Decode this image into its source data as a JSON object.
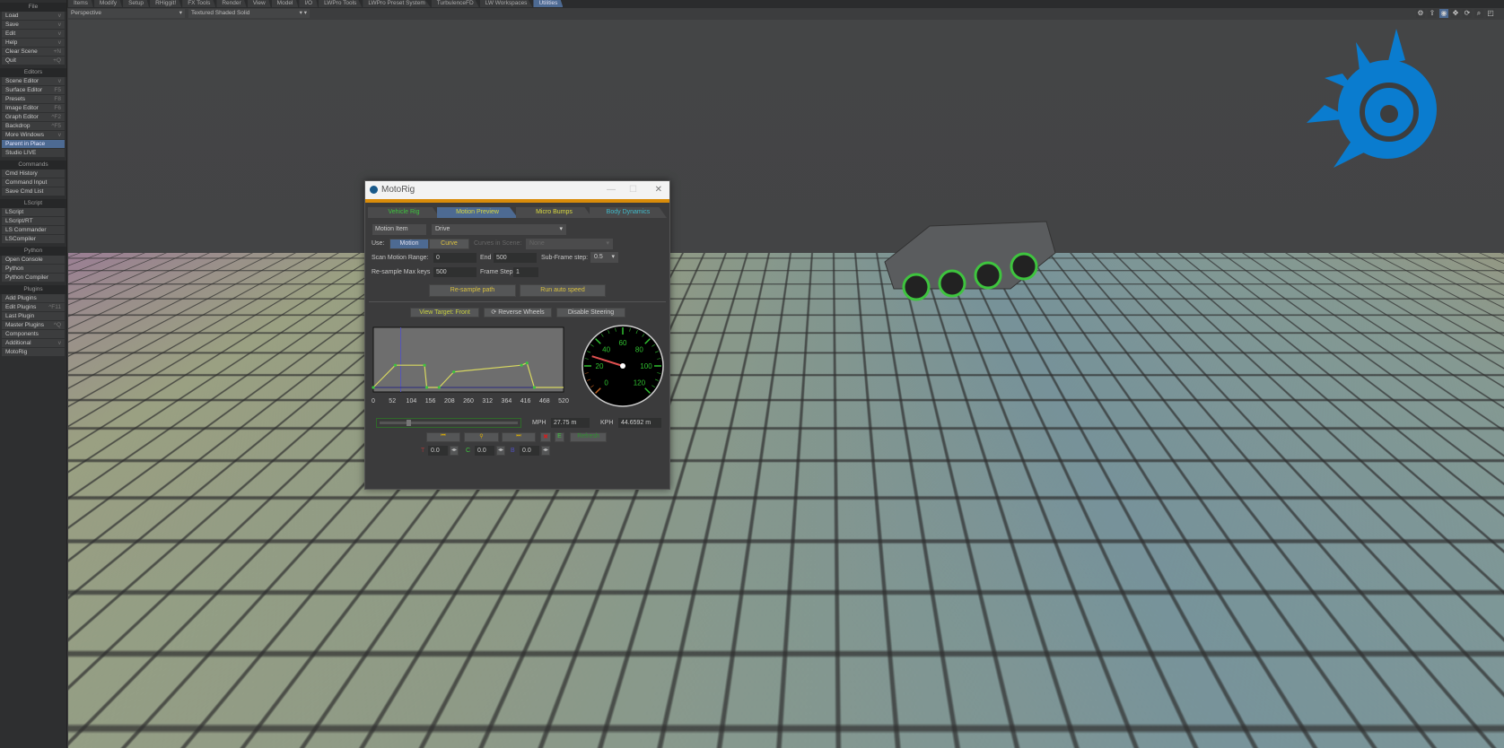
{
  "menu_tabs": [
    "Items",
    "Modify",
    "Setup",
    "RHiggit!",
    "FX Tools",
    "Render",
    "View",
    "Model",
    "I/O",
    "LWPro Tools",
    "LWPro Preset System",
    "TurbulenceFD",
    "LW Workspaces",
    "Utilities"
  ],
  "active_tab": "Utilities",
  "viewbar": {
    "view_mode": "Perspective",
    "render_mode": "Textured Shaded Solid"
  },
  "sidebar": [
    {
      "header": "File",
      "items": [
        {
          "label": "Load",
          "key": "v"
        },
        {
          "label": "Save",
          "key": "v"
        },
        {
          "label": "Edit",
          "key": "v"
        },
        {
          "label": "Help",
          "key": "v"
        },
        {
          "label": "Clear Scene",
          "key": "+N"
        },
        {
          "label": "Quit",
          "key": "+Q"
        }
      ]
    },
    {
      "header": "Editors",
      "items": [
        {
          "label": "Scene Editor",
          "key": "v"
        },
        {
          "label": "Surface Editor",
          "key": "F5"
        },
        {
          "label": "Presets",
          "key": "F8"
        },
        {
          "label": "Image Editor",
          "key": "F6"
        },
        {
          "label": "Graph Editor",
          "key": "^F2"
        },
        {
          "label": "Backdrop",
          "key": "^F5"
        },
        {
          "label": "More Windows",
          "key": "v"
        },
        {
          "label": "Parent in Place",
          "key": "",
          "selected": true
        },
        {
          "label": "Studio LIVE",
          "key": ""
        }
      ]
    },
    {
      "header": "Commands",
      "items": [
        {
          "label": "Cmd History",
          "key": ""
        },
        {
          "label": "Command Input",
          "key": ""
        },
        {
          "label": "Save Cmd List",
          "key": ""
        }
      ]
    },
    {
      "header": "LScript",
      "items": [
        {
          "label": "LScript",
          "key": ""
        },
        {
          "label": "LScript/RT",
          "key": ""
        },
        {
          "label": "LS Commander",
          "key": ""
        },
        {
          "label": "LSCompiler",
          "key": ""
        }
      ]
    },
    {
      "header": "Python",
      "items": [
        {
          "label": "Open Console",
          "key": ""
        },
        {
          "label": "Python",
          "key": ""
        },
        {
          "label": "Python Compiler",
          "key": ""
        }
      ]
    },
    {
      "header": "Plugins",
      "items": [
        {
          "label": "Add Plugins",
          "key": ""
        },
        {
          "label": "Edit Plugins",
          "key": "^F11"
        },
        {
          "label": "Last Plugin",
          "key": ""
        },
        {
          "label": "Master Plugins",
          "key": "^Q"
        },
        {
          "label": "Components",
          "key": ""
        },
        {
          "label": "Additional",
          "key": "v"
        },
        {
          "label": "MotoRig",
          "key": ""
        }
      ]
    }
  ],
  "toolbar_icons": [
    "gear-icon",
    "export-icon",
    "display-icon",
    "move-icon",
    "rotate-icon",
    "zoom-icon",
    "maximize-icon"
  ],
  "dialog": {
    "title": "MotoRig",
    "tabs": [
      {
        "label": "Vehicle Rig",
        "color": "#3ec43e"
      },
      {
        "label": "Motion Preview",
        "color": "#d8d840"
      },
      {
        "label": "Micro Bumps",
        "color": "#d8d840"
      },
      {
        "label": "Body Dynamics",
        "color": "#40b8c8"
      }
    ],
    "active_tab": "Motion Preview",
    "motion_item_label": "Motion Item",
    "motion_item_value": "Drive",
    "use_label": "Use:",
    "use_motion": "Motion",
    "use_curve": "Curve",
    "curves_label": "Curves in Scene:",
    "curves_value": "None",
    "scan_label": "Scan Motion Range:",
    "scan_start": "0",
    "end_label": "End",
    "scan_end": "500",
    "subframe_label": "Sub-Frame step:",
    "subframe_value": "0.5",
    "resample_label": "Re-sample Max keys",
    "resample_value": "500",
    "framestep_label": "Frame Step",
    "framestep_value": "1",
    "resample_btn": "Re-sample path",
    "autospeed_btn": "Run auto speed",
    "view_target_btn": "View Target: Front",
    "reverse_btn": "Reverse Wheels",
    "steering_btn": "Disable Steering",
    "graph": {
      "x_ticks": [
        "0",
        "52",
        "104",
        "156",
        "208",
        "260",
        "312",
        "364",
        "416",
        "468",
        "520"
      ],
      "x_range": [
        0,
        520
      ],
      "y_range": [
        0,
        25
      ],
      "cursor_frame": 75,
      "points": [
        [
          0,
          0
        ],
        [
          60,
          10
        ],
        [
          140,
          10
        ],
        [
          146,
          0
        ],
        [
          180,
          0
        ],
        [
          220,
          7
        ],
        [
          405,
          10
        ],
        [
          420,
          11
        ],
        [
          440,
          0
        ],
        [
          520,
          0
        ]
      ]
    },
    "gauge": {
      "labels": [
        "0",
        "20",
        "40",
        "60",
        "80",
        "100",
        "120"
      ],
      "value": 27.75,
      "max": 120
    },
    "slider_value": 0.2,
    "mph_label": "MPH",
    "mph_value": "27.75 m",
    "kph_label": "KPH",
    "kph_value": "44.6592 m",
    "refresh_btn": "Refresh",
    "e_btn": "E",
    "t_label": "T",
    "t_value": "0.0",
    "c_label": "C",
    "c_value": "0.0",
    "b_label": "B",
    "b_value": "0.0"
  }
}
